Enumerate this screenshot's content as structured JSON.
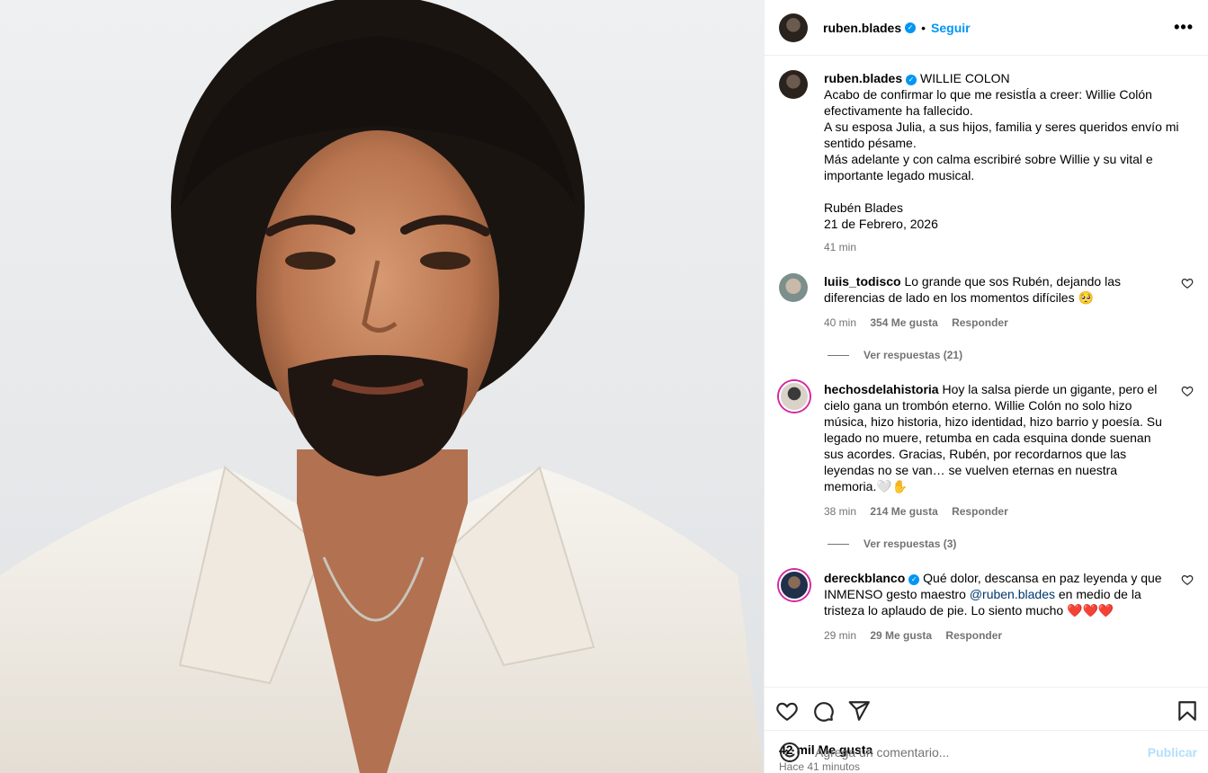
{
  "post": {
    "author": "ruben.blades",
    "follow_label": "Seguir",
    "separator": "•",
    "more_label": "•••"
  },
  "caption": {
    "username": "ruben.blades",
    "lines": [
      "WILLIE COLON",
      "Acabo de confirmar lo que me resistÍa a creer: Willie Colón efectivamente ha fallecido.",
      "A su esposa Julia, a sus hijos, familia y seres queridos envío mi sentido pésame.",
      "Más adelante y con calma escribiré sobre Willie y su vital e importante legado musical.",
      "",
      "Rubén Blades",
      "21 de Febrero, 2026"
    ],
    "time": "41 min"
  },
  "comments": [
    {
      "username": "luiis_todisco",
      "text": "Lo grande que sos Rubén, dejando las diferencias de lado en los momentos difíciles 🥺",
      "time": "40 min",
      "likes": "354 Me gusta",
      "reply_label": "Responder",
      "view_replies": "Ver respuestas (21)"
    },
    {
      "username": "hechosdelahistoria",
      "text": "Hoy la salsa pierde un gigante, pero el cielo gana un trombón eterno. Willie Colón no solo hizo música, hizo historia, hizo identidad, hizo barrio y poesía. Su legado no muere, retumba en cada esquina donde suenan sus acordes. Gracias, Rubén, por recordarnos que las leyendas no se van… se vuelven eternas en nuestra memoria.🤍✋",
      "time": "38 min",
      "likes": "214 Me gusta",
      "reply_label": "Responder",
      "view_replies": "Ver respuestas (3)"
    },
    {
      "username": "dereckblanco",
      "text_before": "Qué dolor, descansa en paz leyenda y que INMENSO gesto maestro ",
      "mention": "@ruben.blades",
      "text_after": " en medio de la tristeza lo aplaudo de pie. Lo siento mucho ❤️❤️❤️",
      "time": "29 min",
      "likes": "29 Me gusta",
      "reply_label": "Responder"
    }
  ],
  "stats": {
    "likes": "42 mil Me gusta",
    "ago": "Hace 41 minutos"
  },
  "composer": {
    "placeholder": "Agrega un comentario...",
    "publish_label": "Publicar"
  },
  "icons": {
    "like": "heart-icon",
    "comment": "comment-icon",
    "share": "share-icon",
    "save": "bookmark-icon",
    "emoji": "emoji-icon",
    "verified": "verified-badge-icon"
  },
  "colors": {
    "link_blue": "#0095f6",
    "muted": "#737373",
    "publish_disabled": "#b2dffc",
    "mention": "#00376b"
  }
}
